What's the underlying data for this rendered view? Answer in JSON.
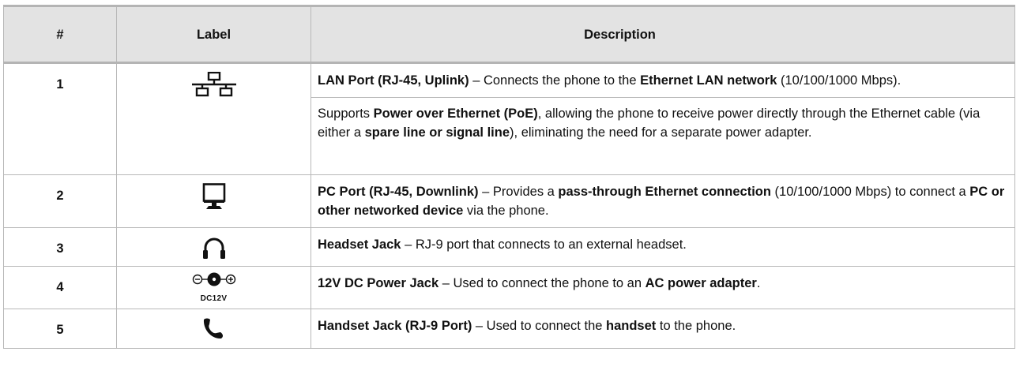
{
  "headers": {
    "num": "#",
    "label": "Label",
    "description": "Description"
  },
  "rows": [
    {
      "num": "1",
      "icon": "lan-network-icon",
      "p1": [
        {
          "t": "LAN Port (RJ-45, Uplink)",
          "b": true
        },
        {
          "t": " – Connects the phone to the ",
          "b": false
        },
        {
          "t": "Ethernet LAN network",
          "b": true
        },
        {
          "t": " (10/100/1000 Mbps).",
          "b": false
        }
      ],
      "p2": [
        {
          "t": "Supports ",
          "b": false
        },
        {
          "t": "Power over Ethernet (PoE)",
          "b": true
        },
        {
          "t": ", allowing the phone to receive power directly through the Ethernet cable (via either a ",
          "b": false
        },
        {
          "t": "spare line or signal line",
          "b": true
        },
        {
          "t": "), eliminating the need for a separate power adapter.",
          "b": false
        }
      ]
    },
    {
      "num": "2",
      "icon": "pc-monitor-icon",
      "p1": [
        {
          "t": "PC Port (RJ-45, Downlink)",
          "b": true
        },
        {
          "t": " – Provides a ",
          "b": false
        },
        {
          "t": "pass-through Ethernet connection",
          "b": true
        },
        {
          "t": " (10/100/1000 Mbps) to connect a ",
          "b": false
        },
        {
          "t": "PC or other networked device",
          "b": true
        },
        {
          "t": " via the phone.",
          "b": false
        }
      ]
    },
    {
      "num": "3",
      "icon": "headset-icon",
      "p1": [
        {
          "t": "Headset Jack",
          "b": true
        },
        {
          "t": " – RJ-9 port that connects to an external headset.",
          "b": false
        }
      ]
    },
    {
      "num": "4",
      "icon": "dc-power-icon",
      "icon_text": "DC12V",
      "p1": [
        {
          "t": "12V DC Power Jack",
          "b": true
        },
        {
          "t": " – Used to connect the phone to an ",
          "b": false
        },
        {
          "t": "AC power adapter",
          "b": true
        },
        {
          "t": ".",
          "b": false
        }
      ]
    },
    {
      "num": "5",
      "icon": "handset-icon",
      "p1": [
        {
          "t": "Handset Jack (RJ-9 Port)",
          "b": true
        },
        {
          "t": " – Used to connect the ",
          "b": false
        },
        {
          "t": "handset",
          "b": true
        },
        {
          "t": " to the phone.",
          "b": false
        }
      ]
    }
  ]
}
